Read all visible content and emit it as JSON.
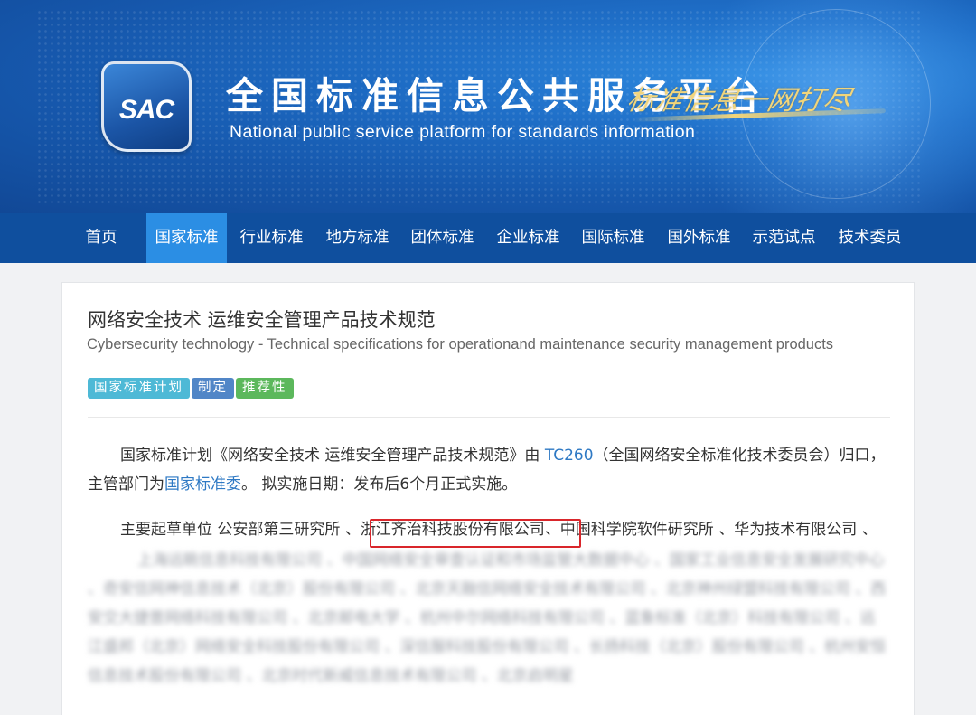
{
  "header": {
    "logo_text": "SAC",
    "title": "全国标准信息公共服务平台",
    "subtitle": "National public service platform  for standards information",
    "slogan": "标准信息一网打尽"
  },
  "nav": {
    "items": [
      {
        "label": "首页"
      },
      {
        "label": "国家标准",
        "active": true
      },
      {
        "label": "行业标准"
      },
      {
        "label": "地方标准"
      },
      {
        "label": "团体标准"
      },
      {
        "label": "企业标准"
      },
      {
        "label": "国际标准"
      },
      {
        "label": "国外标准"
      },
      {
        "label": "示范试点"
      },
      {
        "label": "技术委员"
      }
    ]
  },
  "standard": {
    "title": "网络安全技术 运维安全管理产品技术规范",
    "title_en": "Cybersecurity technology - Technical specifications for operationand maintenance security management products",
    "tags": [
      "国家标准计划",
      "制定",
      "推荐性"
    ],
    "description": {
      "prefix": "国家标准计划《网络安全技术 运维安全管理产品技术规范》由 ",
      "committee_code": "TC260",
      "committee_text": "（全国网络安全标准化技术委员会）归口，主管部门为",
      "department": "国家标准委",
      "suffix": "。 拟实施日期：发布后6个月正式实施。"
    },
    "drafters": {
      "prefix": "主要起草单位 公安部第三研究所 、",
      "highlighted": "浙江齐治科技股份有限公司",
      "suffix": "、中国科学院软件研究所 、华为技术有限公司 、",
      "blurred": "上海远眺信息科技有限公司 、中国网络安全审查认证和市场监管大数据中心 、国家工业信息安全发展研究中心 、奇安信网神信息技术（北京）股份有限公司 、北京天融信网络安全技术有限公司 、北京神州绿盟科技有限公司 、西安交大捷普网络科技有限公司 、北京邮电大学 、杭州中尔网络科技有限公司 、蓝象标准（北京）科技有限公司 、远江盛邦（北京）网络安全科技股份有限公司 、深信服科技股份有限公司 、长扬科技（北京）股份有限公司 、杭州安恒信息技术股份有限公司 、北京时代新威信息技术有限公司 、北京启明星"
    }
  },
  "colors": {
    "nav_bg": "#0f4f9e",
    "nav_active": "#2b8ee4",
    "link": "#2e79c4",
    "highlight_border": "#d9262b",
    "tag_plan": "#4eb9d6",
    "tag_status": "#5186c7",
    "tag_type": "#5cb85c"
  }
}
